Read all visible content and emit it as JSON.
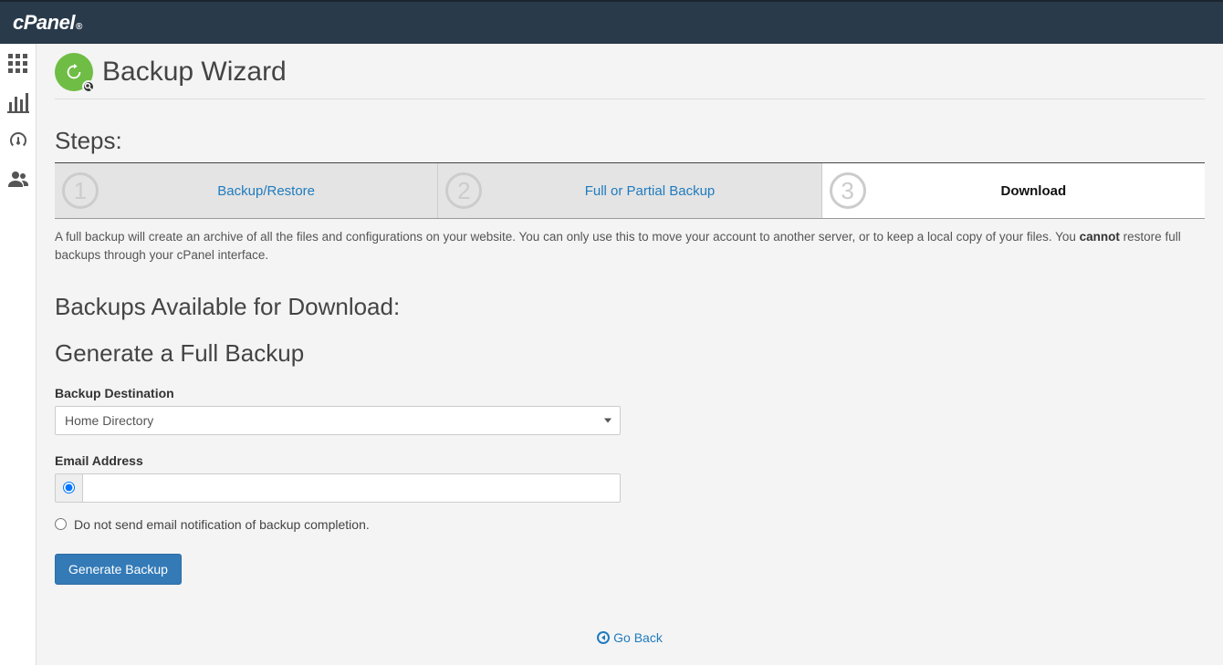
{
  "header": {
    "brand": "cPanel"
  },
  "sidebar_icons": {
    "grid": "apps",
    "stats": "statistics",
    "dashboard": "dashboard",
    "users": "users"
  },
  "page": {
    "title": "Backup Wizard",
    "steps_heading": "Steps:",
    "steps": [
      {
        "num": "1",
        "label": "Backup/Restore",
        "active": false
      },
      {
        "num": "2",
        "label": "Full or Partial Backup",
        "active": false
      },
      {
        "num": "3",
        "label": "Download",
        "active": true
      }
    ],
    "desc_pre": "A full backup will create an archive of all the files and configurations on your website. You can only use this to move your account to another server, or to keep a local copy of your files. You ",
    "desc_bold": "cannot",
    "desc_post": " restore full backups through your cPanel interface.",
    "backups_heading": "Backups Available for Download:",
    "generate_heading": "Generate a Full Backup",
    "dest_label": "Backup Destination",
    "dest_selected": "Home Directory",
    "email_label": "Email Address",
    "email_value": "",
    "no_email_label": "Do not send email notification of backup completion.",
    "generate_button": "Generate Backup",
    "go_back": "Go Back"
  }
}
